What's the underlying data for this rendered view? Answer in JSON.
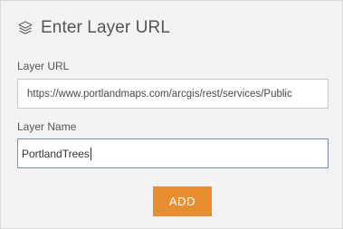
{
  "header": {
    "title": "Enter Layer URL",
    "icon": "layers-icon"
  },
  "form": {
    "url_label": "Layer URL",
    "url_value": "https://www.portlandmaps.com/arcgis/rest/services/Public",
    "name_label": "Layer Name",
    "name_value": "PortlandTrees",
    "add_label": "ADD"
  },
  "colors": {
    "panel_bg": "#f3f3f3",
    "button_accent": "#e88e30",
    "focused_border": "#7d8fa8"
  }
}
